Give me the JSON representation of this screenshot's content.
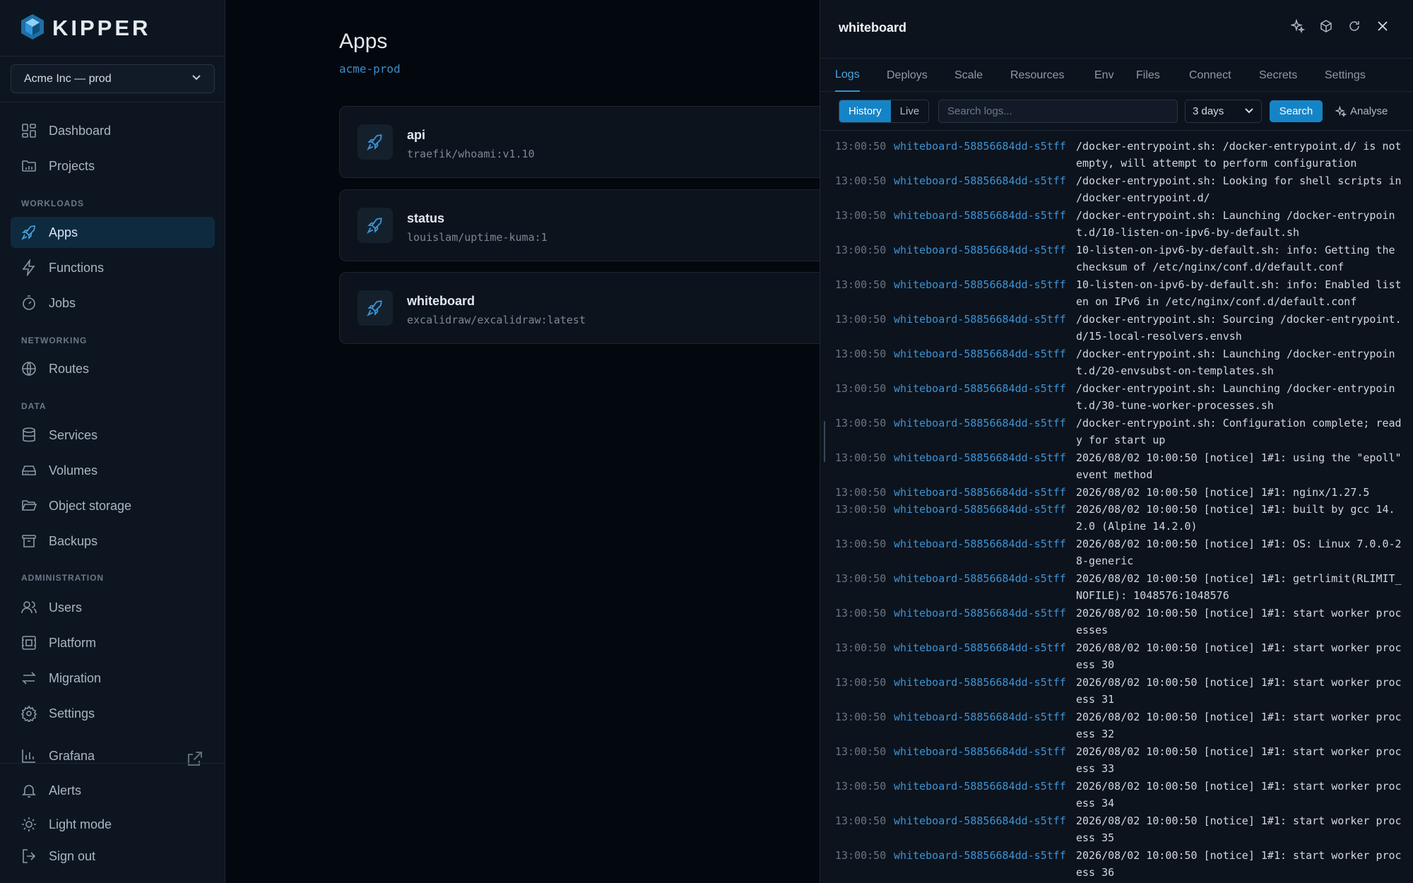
{
  "brand": {
    "name": "KIPPER"
  },
  "org_selector": {
    "value": "Acme Inc — prod"
  },
  "nav": {
    "dashboard": "Dashboard",
    "projects": "Projects",
    "section_workloads": "WORKLOADS",
    "apps": "Apps",
    "functions": "Functions",
    "jobs": "Jobs",
    "section_networking": "NETWORKING",
    "routes": "Routes",
    "section_data": "DATA",
    "services": "Services",
    "volumes": "Volumes",
    "object_storage": "Object storage",
    "backups": "Backups",
    "section_administration": "ADMINISTRATION",
    "users": "Users",
    "platform": "Platform",
    "migration": "Migration",
    "settings": "Settings",
    "grafana": "Grafana",
    "alerts": "Alerts",
    "light_mode": "Light mode",
    "sign_out": "Sign out"
  },
  "main": {
    "title": "Apps",
    "subtitle": "acme-prod",
    "apps": [
      {
        "name": "api",
        "image": "traefik/whoami:v1.10"
      },
      {
        "name": "status",
        "image": "louislam/uptime-kuma:1"
      },
      {
        "name": "whiteboard",
        "image": "excalidraw/excalidraw:latest"
      }
    ]
  },
  "panel": {
    "title": "whiteboard",
    "tabs": [
      "Logs",
      "Deploys",
      "Scale",
      "Resources",
      "Env",
      "Files",
      "Connect",
      "Secrets",
      "Settings"
    ],
    "mode_history": "History",
    "mode_live": "Live",
    "search_placeholder": "Search logs...",
    "range": "3 days",
    "search_button": "Search",
    "analyse_button": "Analyse",
    "logs": [
      {
        "time": "13:00:50",
        "pod": "whiteboard-58856684dd-s5tff",
        "msg": "/docker-entrypoint.sh: /docker-entrypoint.d/ is not empty, will attempt to perform configuration"
      },
      {
        "time": "13:00:50",
        "pod": "whiteboard-58856684dd-s5tff",
        "msg": "/docker-entrypoint.sh: Looking for shell scripts in /docker-entrypoint.d/"
      },
      {
        "time": "13:00:50",
        "pod": "whiteboard-58856684dd-s5tff",
        "msg": "/docker-entrypoint.sh: Launching /docker-entrypoint.d/10-listen-on-ipv6-by-default.sh"
      },
      {
        "time": "13:00:50",
        "pod": "whiteboard-58856684dd-s5tff",
        "msg": "10-listen-on-ipv6-by-default.sh: info: Getting the checksum of /etc/nginx/conf.d/default.conf"
      },
      {
        "time": "13:00:50",
        "pod": "whiteboard-58856684dd-s5tff",
        "msg": "10-listen-on-ipv6-by-default.sh: info: Enabled listen on IPv6 in /etc/nginx/conf.d/default.conf"
      },
      {
        "time": "13:00:50",
        "pod": "whiteboard-58856684dd-s5tff",
        "msg": "/docker-entrypoint.sh: Sourcing /docker-entrypoint.d/15-local-resolvers.envsh"
      },
      {
        "time": "13:00:50",
        "pod": "whiteboard-58856684dd-s5tff",
        "msg": "/docker-entrypoint.sh: Launching /docker-entrypoint.d/20-envsubst-on-templates.sh"
      },
      {
        "time": "13:00:50",
        "pod": "whiteboard-58856684dd-s5tff",
        "msg": "/docker-entrypoint.sh: Launching /docker-entrypoint.d/30-tune-worker-processes.sh"
      },
      {
        "time": "13:00:50",
        "pod": "whiteboard-58856684dd-s5tff",
        "msg": "/docker-entrypoint.sh: Configuration complete; ready for start up"
      },
      {
        "time": "13:00:50",
        "pod": "whiteboard-58856684dd-s5tff",
        "msg": "2026/08/02 10:00:50 [notice] 1#1: using the \"epoll\" event method"
      },
      {
        "time": "13:00:50",
        "pod": "whiteboard-58856684dd-s5tff",
        "msg": "2026/08/02 10:00:50 [notice] 1#1: nginx/1.27.5"
      },
      {
        "time": "13:00:50",
        "pod": "whiteboard-58856684dd-s5tff",
        "msg": "2026/08/02 10:00:50 [notice] 1#1: built by gcc 14.2.0 (Alpine 14.2.0)"
      },
      {
        "time": "13:00:50",
        "pod": "whiteboard-58856684dd-s5tff",
        "msg": "2026/08/02 10:00:50 [notice] 1#1: OS: Linux 7.0.0-28-generic"
      },
      {
        "time": "13:00:50",
        "pod": "whiteboard-58856684dd-s5tff",
        "msg": "2026/08/02 10:00:50 [notice] 1#1: getrlimit(RLIMIT_NOFILE): 1048576:1048576"
      },
      {
        "time": "13:00:50",
        "pod": "whiteboard-58856684dd-s5tff",
        "msg": "2026/08/02 10:00:50 [notice] 1#1: start worker processes"
      },
      {
        "time": "13:00:50",
        "pod": "whiteboard-58856684dd-s5tff",
        "msg": "2026/08/02 10:00:50 [notice] 1#1: start worker process 30"
      },
      {
        "time": "13:00:50",
        "pod": "whiteboard-58856684dd-s5tff",
        "msg": "2026/08/02 10:00:50 [notice] 1#1: start worker process 31"
      },
      {
        "time": "13:00:50",
        "pod": "whiteboard-58856684dd-s5tff",
        "msg": "2026/08/02 10:00:50 [notice] 1#1: start worker process 32"
      },
      {
        "time": "13:00:50",
        "pod": "whiteboard-58856684dd-s5tff",
        "msg": "2026/08/02 10:00:50 [notice] 1#1: start worker process 33"
      },
      {
        "time": "13:00:50",
        "pod": "whiteboard-58856684dd-s5tff",
        "msg": "2026/08/02 10:00:50 [notice] 1#1: start worker process 34"
      },
      {
        "time": "13:00:50",
        "pod": "whiteboard-58856684dd-s5tff",
        "msg": "2026/08/02 10:00:50 [notice] 1#1: start worker process 35"
      },
      {
        "time": "13:00:50",
        "pod": "whiteboard-58856684dd-s5tff",
        "msg": "2026/08/02 10:00:50 [notice] 1#1: start worker process 36"
      }
    ]
  },
  "icons": {
    "logo": "kipper-logo-icon",
    "dashboard": "dashboard-icon",
    "projects": "folder-icon",
    "apps": "rocket-icon",
    "functions": "lightning-icon",
    "jobs": "timer-icon",
    "routes": "globe-icon",
    "services": "database-icon",
    "volumes": "drive-icon",
    "object_storage": "folder-open-icon",
    "backups": "archive-icon",
    "users": "users-icon",
    "platform": "platform-icon",
    "migration": "arrows-icon",
    "settings": "gear-icon",
    "grafana": "bar-chart-icon",
    "alerts": "bell-icon",
    "light_mode": "sun-icon",
    "sign_out": "sign-out-icon"
  },
  "colors": {
    "accent": "#1584c7",
    "link": "#3d93d4",
    "background": "#03070e",
    "sidebar": "#0d1520"
  }
}
